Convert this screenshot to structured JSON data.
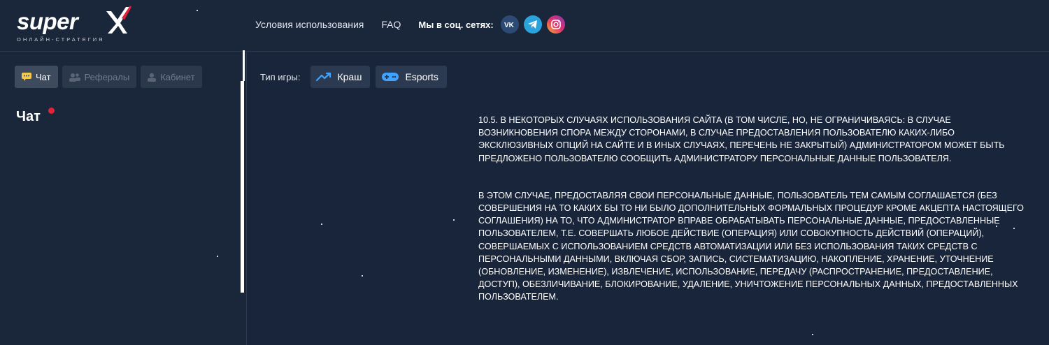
{
  "header": {
    "logo_text": "super",
    "logo_subtitle": "ОНЛАЙН-СТРАТЕГИЯ",
    "nav": [
      {
        "label": "Условия использования"
      },
      {
        "label": "FAQ"
      }
    ],
    "social_label": "Мы в соц. сетях:",
    "social": [
      "vk-icon",
      "telegram-icon",
      "instagram-icon"
    ]
  },
  "sidebar": {
    "tabs": [
      {
        "label": "Чат",
        "icon": "chat-icon",
        "active": true
      },
      {
        "label": "Рефералы",
        "icon": "users-icon",
        "active": false
      },
      {
        "label": "Кабинет",
        "icon": "user-icon",
        "active": false
      }
    ],
    "chat_title": "Чат"
  },
  "game_bar": {
    "label": "Тип игры:",
    "buttons": [
      {
        "label": "Краш",
        "icon": "trend-up-icon"
      },
      {
        "label": "Esports",
        "icon": "gamepad-icon"
      }
    ]
  },
  "content": {
    "paragraphs": [
      "10.5. В некоторых случаях использования сайта (в том числе, но, не ограничиваясь: в случае возникновения спора между сторонами, в случае предоставления пользователю каких-либо эксклюзивных опций на сайте и в иных случаях, перечень не закрытый) администратором может быть предложено пользователю сообщить администратору персональные данные пользователя.",
      "В этом случае, предоставляя свои персональные данные, пользователь тем самым соглашается (без совершения на то каких бы то ни было дополнительных формальных процедур кроме акцепта настоящего соглашения) на то, что администратор вправе обрабатывать персональные данные, предоставленные пользователем, т.е. совершать любое действие (операция) или совокупность действий (операций), совершаемых с использованием средств автоматизации или без использования таких средств с персональными данными, включая сбор, запись, систематизацию, накопление, хранение, уточнение (обновление, изменение), извлечение, использование, передачу (распространение, предоставление, доступ), обезличивание, блокирование, удаление, уничтожение персональных данных, предоставленных пользователем."
    ]
  },
  "colors": {
    "background": "#19253a",
    "accent_red": "#e5203a",
    "tab_active": "#3e4a5e",
    "tab_inactive": "#2b374b"
  }
}
